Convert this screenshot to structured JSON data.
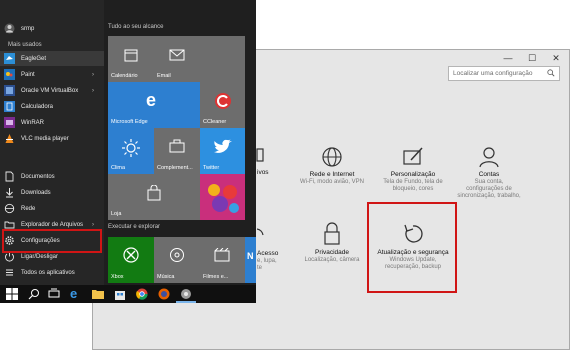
{
  "settings": {
    "search_placeholder": "Localizar uma configuração",
    "categories": [
      {
        "title": "ivos",
        "desc1": "",
        "desc2": "",
        "desc3": "",
        "icon": "devices-icon"
      },
      {
        "title": "Rede e Internet",
        "desc1": "Wi-Fi, modo avião, VPN",
        "desc2": "",
        "desc3": "",
        "icon": "globe-icon"
      },
      {
        "title": "Personalização",
        "desc1": "Tela de Fundo, tela de",
        "desc2": "bloqueio, cores",
        "desc3": "",
        "icon": "personalization-icon"
      },
      {
        "title": "Contas",
        "desc1": "Sua conta,",
        "desc2": "configurações de",
        "desc3": "sincronização, trabalho,",
        "icon": "account-icon"
      },
      {
        "title": "Acesso",
        "desc1": "e, lupa,",
        "desc2": "te",
        "desc3": "",
        "icon": "ease-of-access-icon"
      },
      {
        "title": "Privacidade",
        "desc1": "Localização, câmera",
        "desc2": "",
        "desc3": "",
        "icon": "lock-icon"
      },
      {
        "title": "Atualização e segurança",
        "desc1": "Windows Update,",
        "desc2": "recuperação, backup",
        "desc3": "",
        "icon": "refresh-icon"
      }
    ]
  },
  "start": {
    "user": "srmp",
    "most_used_label": "Mais usados",
    "apps": [
      "EagleGet",
      "Paint",
      "Oracle VM VirtualBox",
      "Calculadora",
      "WinRAR",
      "VLC media player"
    ],
    "places": [
      "Documentos",
      "Downloads",
      "Rede",
      "Explorador de Arquivos",
      "Configurações",
      "Ligar/Desligar",
      "Todos os aplicativos"
    ],
    "tiles_header": "Tudo ao seu alcance",
    "play_header": "Executar e explorar",
    "tiles": {
      "calendario": "Calendário",
      "email": "Email",
      "edge": "Microsoft Edge",
      "ccleaner": "CCleaner",
      "clima": "Clima",
      "complementos": "Complement...",
      "twitter": "Twitter",
      "loja": "Loja",
      "xbox": "Xbox",
      "musica": "Música",
      "filmes": "Filmes e...",
      "play_letter": "N"
    }
  },
  "colors": {
    "tile_blue": "#2d7fd0",
    "tile_gray": "#6d6d6d",
    "tile_green": "#127b12",
    "highlight_red": "#d01515"
  }
}
